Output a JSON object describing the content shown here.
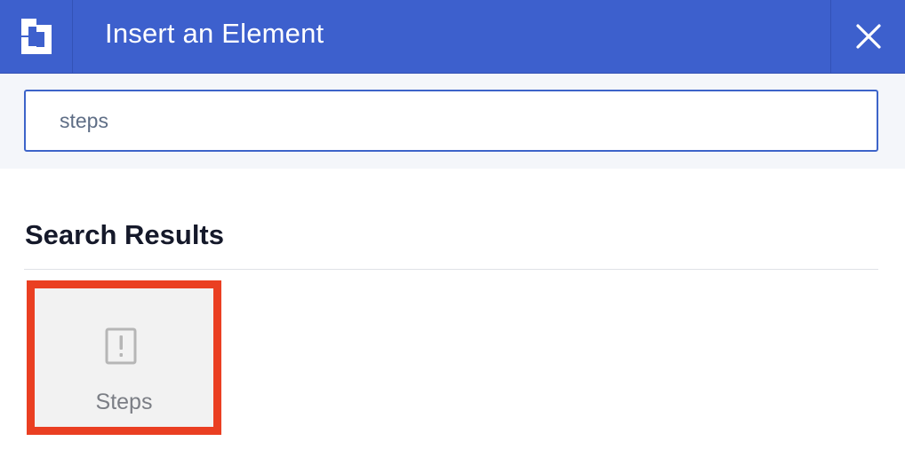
{
  "header": {
    "title": "Insert an Element",
    "logo_icon": "builder-logo-icon",
    "close_icon": "close-icon",
    "background_color": "#3d60cd"
  },
  "search": {
    "value": "steps",
    "border_color": "#3d64c9"
  },
  "results": {
    "heading": "Search Results",
    "items": [
      {
        "label": "Steps",
        "icon": "alert-square-icon",
        "highlighted": true,
        "highlight_color": "#ea3f22"
      }
    ]
  }
}
